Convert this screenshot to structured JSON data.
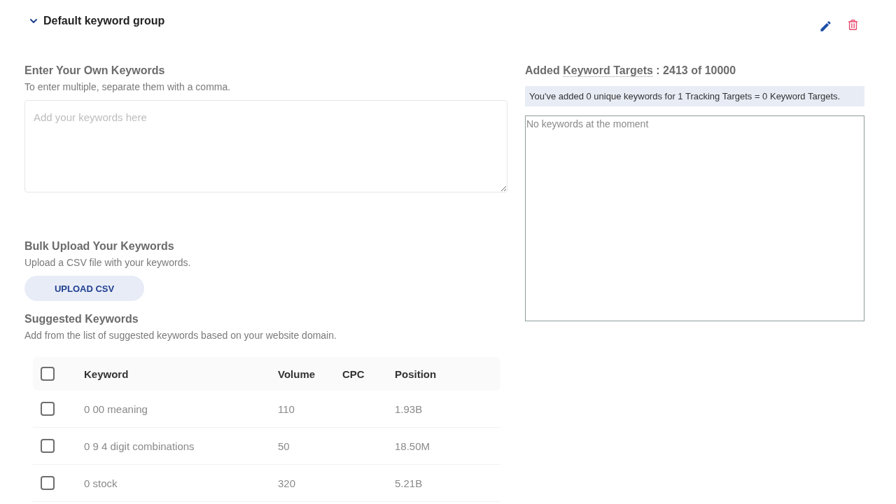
{
  "group": {
    "title": "Default keyword group",
    "expanded": true
  },
  "own_keywords": {
    "heading": "Enter Your Own Keywords",
    "hint": "To enter multiple, separate them with a comma.",
    "placeholder": "Add your keywords here"
  },
  "bulk_upload": {
    "heading": "Bulk Upload Your Keywords",
    "hint": "Upload a CSV file with your keywords.",
    "button": "UPLOAD CSV"
  },
  "suggested": {
    "heading": "Suggested Keywords",
    "hint": "Add from the list of suggested keywords based on your website domain.",
    "table": {
      "select_all_checked": false,
      "columns": [
        "Keyword",
        "Volume",
        "CPC",
        "Position"
      ],
      "rows": [
        {
          "checked": false,
          "keyword": "0 00 meaning",
          "volume": "110",
          "position": "1.93B"
        },
        {
          "checked": false,
          "keyword": "0 9 4 digit combinations",
          "volume": "50",
          "position": "18.50M"
        },
        {
          "checked": false,
          "keyword": "0 stock",
          "volume": "320",
          "position": "5.21B"
        }
      ]
    }
  },
  "targets": {
    "heading_start": "Added",
    "heading_term": "Keyword Targets",
    "heading_end": ": 2413 of 10000",
    "summary": "You've added 0 unique keywords for 1 Tracking Targets = 0 Keyword Targets.",
    "empty_text": "No keywords at the moment"
  }
}
